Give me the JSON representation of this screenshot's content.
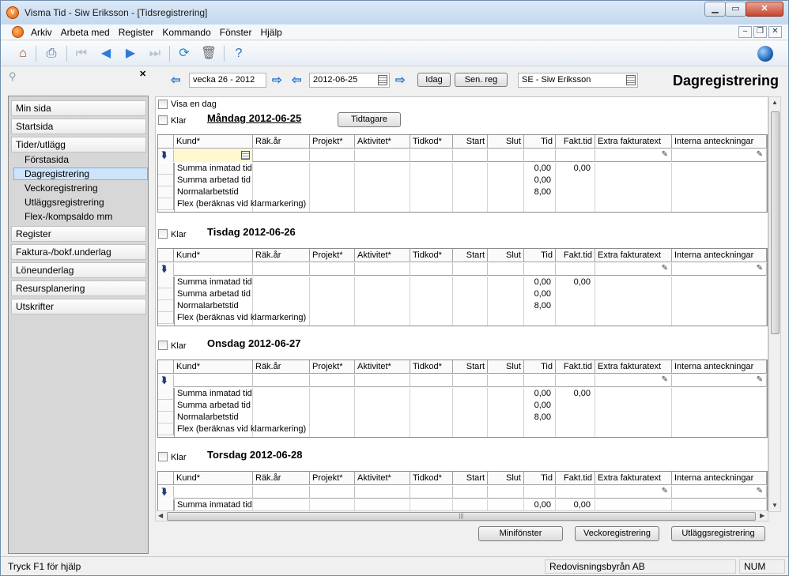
{
  "window": {
    "title": "Visma Tid - Siw Eriksson - [Tidsregistrering]"
  },
  "menu": [
    "Arkiv",
    "Arbeta med",
    "Register",
    "Kommando",
    "Fönster",
    "Hjälp"
  ],
  "sidebar": {
    "items": [
      {
        "label": "Min sida",
        "type": "section"
      },
      {
        "label": "Startsida",
        "type": "section"
      },
      {
        "label": "Tider/utlägg",
        "type": "section"
      },
      {
        "label": "Förstasida",
        "type": "sub"
      },
      {
        "label": "Dagregistrering",
        "type": "sub",
        "active": true
      },
      {
        "label": "Veckoregistrering",
        "type": "sub"
      },
      {
        "label": "Utläggsregistrering",
        "type": "sub"
      },
      {
        "label": "Flex-/kompsaldo mm",
        "type": "sub"
      },
      {
        "label": "Register",
        "type": "section"
      },
      {
        "label": "Faktura-/bokf.underlag",
        "type": "section"
      },
      {
        "label": "Löneunderlag",
        "type": "section"
      },
      {
        "label": "Resursplanering",
        "type": "section"
      },
      {
        "label": "Utskrifter",
        "type": "section"
      }
    ]
  },
  "nav": {
    "week": "vecka 26 - 2012",
    "date": "2012-06-25",
    "today_label": "Idag",
    "last_reg_label": "Sen. reg",
    "person": "SE - Siw Eriksson",
    "page_title": "Dagregistrering"
  },
  "options": {
    "show_one_day": "Visa en dag",
    "done_label": "Klar",
    "timer_button": "Tidtagare"
  },
  "columns": [
    "Kund*",
    "Räk.år",
    "Projekt*",
    "Aktivitet*",
    "Tidkod*",
    "Start",
    "Slut",
    "Tid",
    "Fakt.tid",
    "Extra fakturatext",
    "Interna anteckningar"
  ],
  "summary_labels": [
    "Summa inmatad tid",
    "Summa arbetad tid",
    "Normalarbetstid",
    "Flex (beräknas vid klarmarkering)"
  ],
  "days": [
    {
      "title": "Måndag 2012-06-25",
      "inmatad": "0,00",
      "inmatad_fakt": "0,00",
      "arbetad": "0,00",
      "normal": "8,00"
    },
    {
      "title": "Tisdag 2012-06-26",
      "inmatad": "0,00",
      "inmatad_fakt": "0,00",
      "arbetad": "0,00",
      "normal": "8,00"
    },
    {
      "title": "Onsdag 2012-06-27",
      "inmatad": "0,00",
      "inmatad_fakt": "0,00",
      "arbetad": "0,00",
      "normal": "8,00"
    },
    {
      "title": "Torsdag 2012-06-28",
      "inmatad": "0,00",
      "inmatad_fakt": "0,00"
    }
  ],
  "bottom_buttons": [
    "Minifönster",
    "Veckoregistrering",
    "Utläggsregistrering"
  ],
  "status": {
    "help": "Tryck F1 för hjälp",
    "company": "Redovisningsbyrån AB",
    "num": "NUM"
  }
}
